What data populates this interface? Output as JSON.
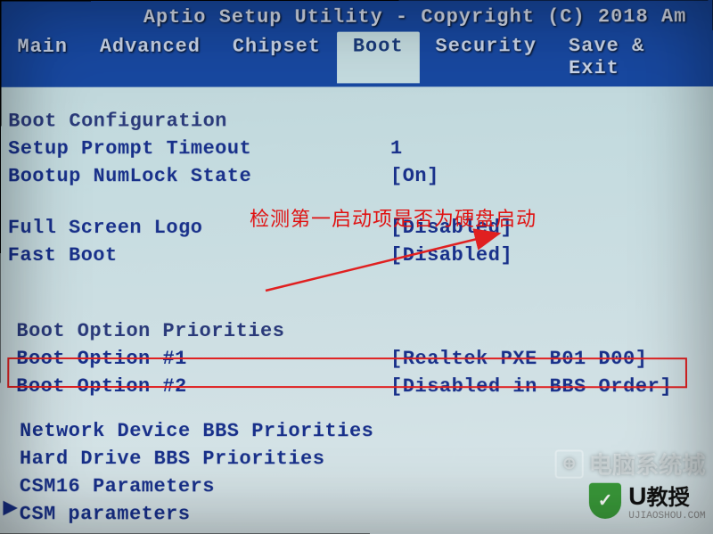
{
  "header": {
    "title": "Aptio Setup Utility - Copyright (C) 2018 Am"
  },
  "menu": {
    "items": [
      {
        "label": "Main"
      },
      {
        "label": "Advanced"
      },
      {
        "label": "Chipset"
      },
      {
        "label": "Boot",
        "active": true
      },
      {
        "label": "Security"
      },
      {
        "label": "Save & Exit"
      }
    ]
  },
  "boot": {
    "section_title": "Boot Configuration",
    "setup_prompt_label": "Setup Prompt Timeout",
    "setup_prompt_value": "1",
    "numlock_label": "Bootup NumLock State",
    "numlock_value": "[On]",
    "full_logo_label": "Full Screen Logo",
    "full_logo_value": "[Disabled]",
    "fast_boot_label": "Fast Boot",
    "fast_boot_value": "[Disabled]",
    "priorities_title": "Boot Option Priorities",
    "option1_label": "Boot Option #1",
    "option1_value": "[Realtek PXE B01 D00]",
    "option2_label": "Boot Option #2",
    "option2_value": "[Disabled in BBS Order]",
    "net_bbs": "Network Device BBS Priorities",
    "hdd_bbs": "Hard Drive BBS Priorities",
    "csm16": "CSM16 Parameters",
    "csm": "CSM parameters"
  },
  "annotation": {
    "text": "检测第一启动项是否为硬盘启动",
    "highlight_color": "#e02020"
  },
  "watermarks": {
    "w1_text": "电脑系统城",
    "w1_icon": "⊕",
    "w2_letter": "U",
    "w2_text": "教授",
    "w2_sub": "UJIAOSHOU.COM",
    "shield_icon": "✓"
  }
}
